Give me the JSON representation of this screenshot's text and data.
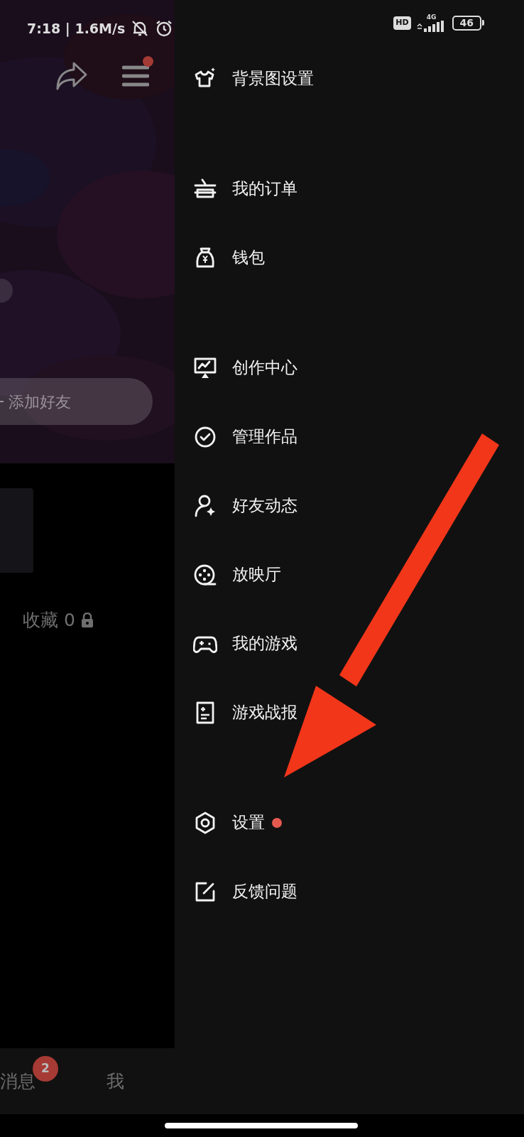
{
  "status_bar": {
    "time": "7:18 | 1.6M/s",
    "hd": "HD",
    "network": "4G",
    "battery": "46"
  },
  "header": {
    "menu_has_notification": true
  },
  "profile": {
    "add_friend_button": "添加好友",
    "favorites_label": "收藏 0",
    "favorites_locked": true
  },
  "bottom_nav": [
    {
      "label": "消息",
      "badge": "2"
    },
    {
      "label": "我"
    }
  ],
  "drawer": {
    "groups": [
      {
        "items": [
          {
            "label": "背景图设置",
            "has_dot": false
          }
        ]
      },
      {
        "items": [
          {
            "label": "我的订单",
            "has_dot": false
          },
          {
            "label": "钱包",
            "has_dot": false
          }
        ]
      },
      {
        "items": [
          {
            "label": "创作中心",
            "has_dot": false
          },
          {
            "label": "管理作品",
            "has_dot": false
          },
          {
            "label": "好友动态",
            "has_dot": false
          },
          {
            "label": "放映厅",
            "has_dot": false
          },
          {
            "label": "我的游戏",
            "has_dot": false
          },
          {
            "label": "游戏战报",
            "has_dot": false
          }
        ]
      },
      {
        "items": [
          {
            "label": "设置",
            "has_dot": true
          },
          {
            "label": "反馈问题",
            "has_dot": false
          }
        ]
      }
    ]
  },
  "annotation": {
    "kind": "arrow"
  }
}
